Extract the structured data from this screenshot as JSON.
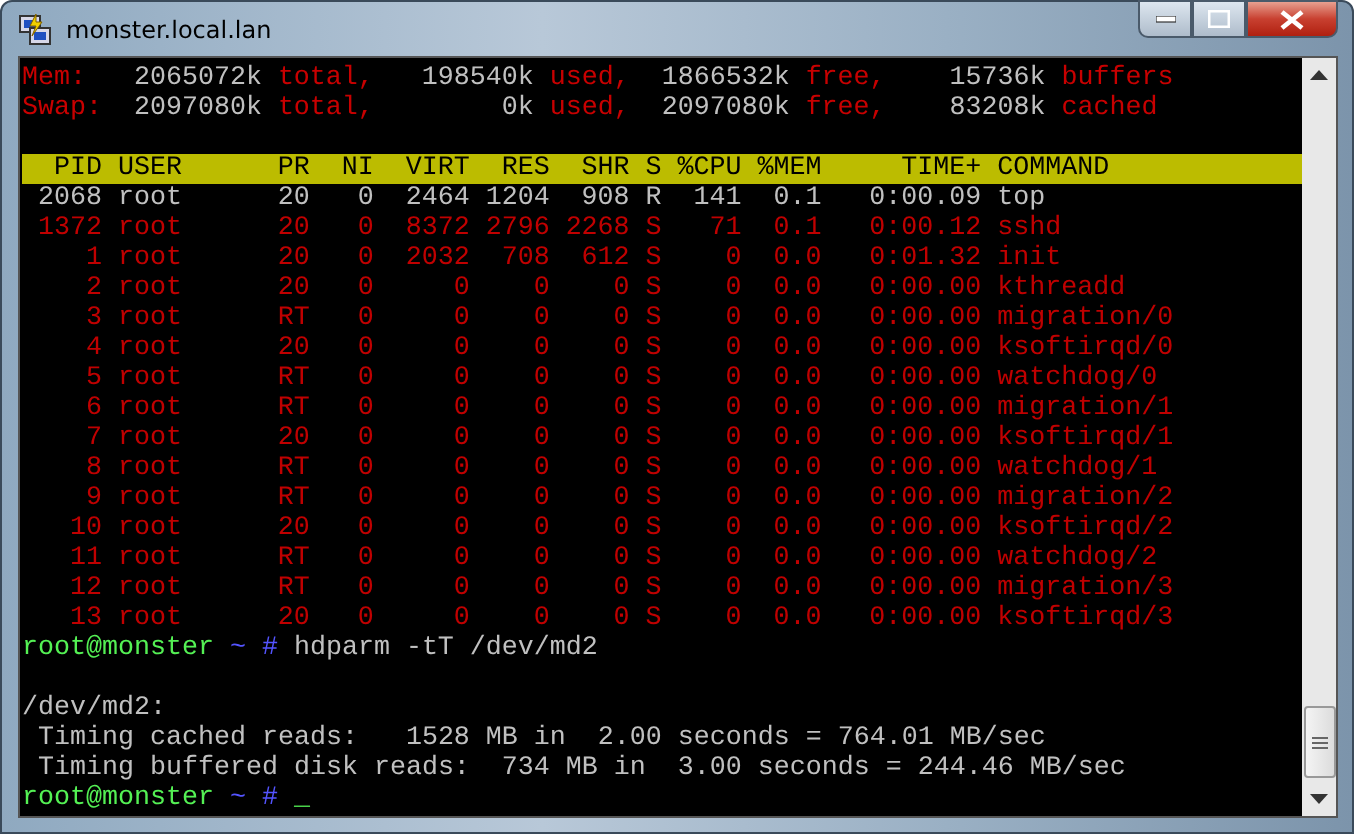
{
  "window": {
    "title": "monster.local.lan"
  },
  "summary": [
    {
      "segments": [
        {
          "kind": "label",
          "text": "Mem:"
        },
        {
          "kind": "value",
          "text": "2065072k"
        },
        {
          "kind": "label",
          "text": "total,"
        },
        {
          "kind": "value",
          "text": "198540k"
        },
        {
          "kind": "label",
          "text": "used,"
        },
        {
          "kind": "value",
          "text": "1866532k"
        },
        {
          "kind": "label",
          "text": "free,"
        },
        {
          "kind": "value",
          "text": "15736k"
        },
        {
          "kind": "label",
          "text": "buffers"
        }
      ]
    },
    {
      "segments": [
        {
          "kind": "label",
          "text": "Swap:"
        },
        {
          "kind": "value",
          "text": "2097080k"
        },
        {
          "kind": "label",
          "text": "total,"
        },
        {
          "kind": "value",
          "text": "0k"
        },
        {
          "kind": "label",
          "text": "used,"
        },
        {
          "kind": "value",
          "text": "2097080k"
        },
        {
          "kind": "label",
          "text": "free,"
        },
        {
          "kind": "value",
          "text": "83208k"
        },
        {
          "kind": "label",
          "text": "cached"
        }
      ]
    }
  ],
  "process_table": {
    "columns": [
      "PID",
      "USER",
      "PR",
      "NI",
      "VIRT",
      "RES",
      "SHR",
      "S",
      "%CPU",
      "%MEM",
      "TIME+",
      "COMMAND"
    ],
    "rows": [
      {
        "color": "#c0c0c0",
        "cells": [
          "2068",
          "root",
          "20",
          "0",
          "2464",
          "1204",
          "908",
          "R",
          "141",
          "0.1",
          "0:00.09",
          "top"
        ]
      },
      {
        "color": "#c00000",
        "cells": [
          "1372",
          "root",
          "20",
          "0",
          "8372",
          "2796",
          "2268",
          "S",
          "71",
          "0.1",
          "0:00.12",
          "sshd"
        ]
      },
      {
        "color": "#c00000",
        "cells": [
          "1",
          "root",
          "20",
          "0",
          "2032",
          "708",
          "612",
          "S",
          "0",
          "0.0",
          "0:01.32",
          "init"
        ]
      },
      {
        "color": "#c00000",
        "cells": [
          "2",
          "root",
          "20",
          "0",
          "0",
          "0",
          "0",
          "S",
          "0",
          "0.0",
          "0:00.00",
          "kthreadd"
        ]
      },
      {
        "color": "#c00000",
        "cells": [
          "3",
          "root",
          "RT",
          "0",
          "0",
          "0",
          "0",
          "S",
          "0",
          "0.0",
          "0:00.00",
          "migration/0"
        ]
      },
      {
        "color": "#c00000",
        "cells": [
          "4",
          "root",
          "20",
          "0",
          "0",
          "0",
          "0",
          "S",
          "0",
          "0.0",
          "0:00.00",
          "ksoftirqd/0"
        ]
      },
      {
        "color": "#c00000",
        "cells": [
          "5",
          "root",
          "RT",
          "0",
          "0",
          "0",
          "0",
          "S",
          "0",
          "0.0",
          "0:00.00",
          "watchdog/0"
        ]
      },
      {
        "color": "#c00000",
        "cells": [
          "6",
          "root",
          "RT",
          "0",
          "0",
          "0",
          "0",
          "S",
          "0",
          "0.0",
          "0:00.00",
          "migration/1"
        ]
      },
      {
        "color": "#c00000",
        "cells": [
          "7",
          "root",
          "20",
          "0",
          "0",
          "0",
          "0",
          "S",
          "0",
          "0.0",
          "0:00.00",
          "ksoftirqd/1"
        ]
      },
      {
        "color": "#c00000",
        "cells": [
          "8",
          "root",
          "RT",
          "0",
          "0",
          "0",
          "0",
          "S",
          "0",
          "0.0",
          "0:00.00",
          "watchdog/1"
        ]
      },
      {
        "color": "#c00000",
        "cells": [
          "9",
          "root",
          "RT",
          "0",
          "0",
          "0",
          "0",
          "S",
          "0",
          "0.0",
          "0:00.00",
          "migration/2"
        ]
      },
      {
        "color": "#c00000",
        "cells": [
          "10",
          "root",
          "20",
          "0",
          "0",
          "0",
          "0",
          "S",
          "0",
          "0.0",
          "0:00.00",
          "ksoftirqd/2"
        ]
      },
      {
        "color": "#c00000",
        "cells": [
          "11",
          "root",
          "RT",
          "0",
          "0",
          "0",
          "0",
          "S",
          "0",
          "0.0",
          "0:00.00",
          "watchdog/2"
        ]
      },
      {
        "color": "#c00000",
        "cells": [
          "12",
          "root",
          "RT",
          "0",
          "0",
          "0",
          "0",
          "S",
          "0",
          "0.0",
          "0:00.00",
          "migration/3"
        ]
      },
      {
        "color": "#c00000",
        "cells": [
          "13",
          "root",
          "20",
          "0",
          "0",
          "0",
          "0",
          "S",
          "0",
          "0.0",
          "0:00.00",
          "ksoftirqd/3"
        ]
      }
    ]
  },
  "session": [
    {
      "kind": "prompt",
      "host": "root@monster",
      "path": "~ #",
      "command": "hdparm -tT /dev/md2"
    },
    {
      "kind": "blank"
    },
    {
      "kind": "output",
      "heading": "/dev/md2:",
      "lines": [
        "Timing cached reads:   1528 MB in  2.00 seconds = 764.01 MB/sec",
        "Timing buffered disk reads:  734 MB in  3.00 seconds = 244.46 MB/sec"
      ]
    },
    {
      "kind": "prompt",
      "host": "root@monster",
      "path": "~ #",
      "cursor": "_"
    }
  ]
}
